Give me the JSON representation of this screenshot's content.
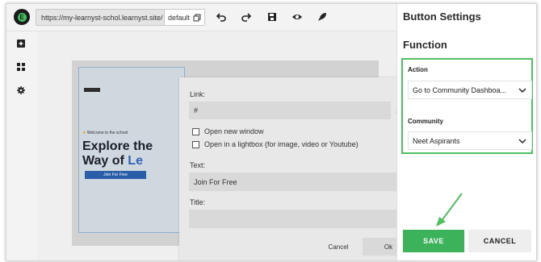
{
  "toolbar": {
    "url": "https://my-learnyst-schol.learnyst.site/",
    "version": "default",
    "icons": [
      "undo-icon",
      "redo-icon",
      "save-icon",
      "preview-icon",
      "publish-icon"
    ]
  },
  "sidebar": {
    "icons": [
      "add-icon",
      "widgets-icon",
      "settings-icon"
    ]
  },
  "canvas": {
    "welcome": "Welcome to the school",
    "headline_line1": "Explore the",
    "headline_line2a": "Way of ",
    "headline_line2b": "Le",
    "join_button": "Join For Free"
  },
  "link_dialog": {
    "link_label": "Link:",
    "link_value": "#",
    "open_new_window": "Open new window",
    "open_lightbox": "Open in a lightbox (for image, video or Youtube)",
    "text_label": "Text:",
    "text_value": "Join For Free",
    "title_label": "Title:",
    "title_value": "",
    "cancel": "Cancel",
    "ok": "Ok"
  },
  "settings": {
    "title": "Button Settings",
    "section": "Function",
    "action_label": "Action",
    "action_value": "Go to Community Dashboa...",
    "community_label": "Community",
    "community_value": "Neet Aspirants",
    "save": "SAVE",
    "cancel": "CANCEL",
    "highlight_color": "#4fbf61",
    "save_color": "#3cb35a"
  }
}
